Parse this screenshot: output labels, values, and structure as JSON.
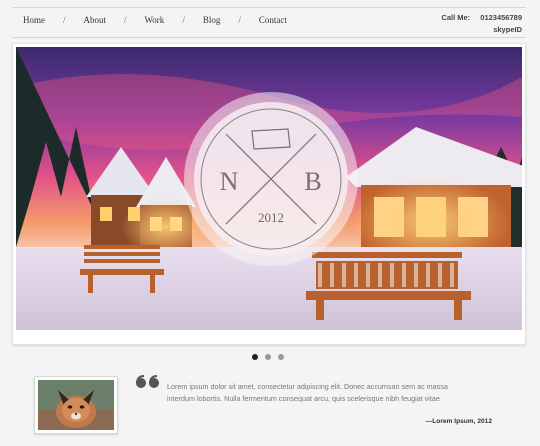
{
  "nav": {
    "items": [
      {
        "label": "Home"
      },
      {
        "label": "About"
      },
      {
        "label": "Work"
      },
      {
        "label": "Blog"
      },
      {
        "label": "Contact"
      }
    ],
    "separator": "/"
  },
  "contact": {
    "call_label": "Call Me:",
    "phone": "0123456789",
    "skype": "skypeID"
  },
  "slider": {
    "logo_left": "N",
    "logo_right": "B",
    "logo_year": "2012",
    "dots": [
      {
        "active": true
      },
      {
        "active": false
      },
      {
        "active": false
      }
    ]
  },
  "testimonial": {
    "quote": "Lorem ipsum dolor sit amet, consectetur adipiscing elit. Donec accumsan sem ac massa interdum lobortis. Nulla fermentum consequat arcu, quis scelerisque nibh feugiat vitae",
    "author": "—Lorem Ipsum, 2012"
  },
  "colors": {
    "accent": "#333333",
    "dot_active": "#222222",
    "dot_inactive": "#999999"
  }
}
